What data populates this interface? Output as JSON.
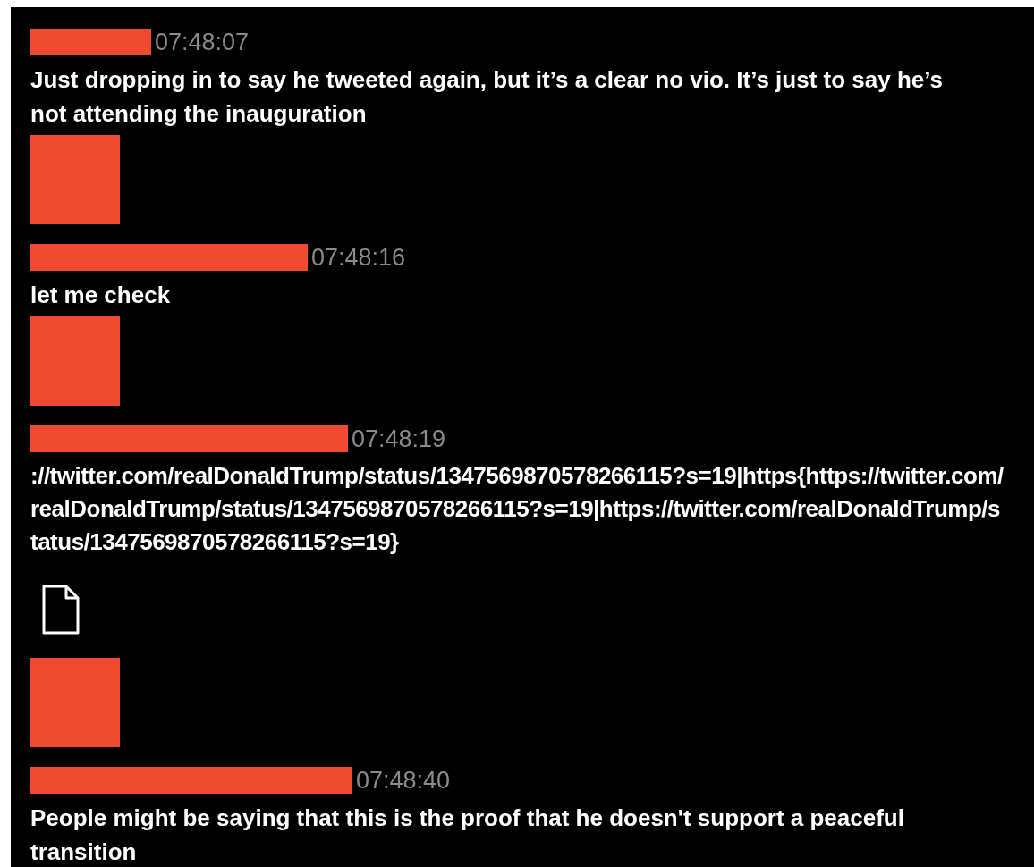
{
  "messages": [
    {
      "kind": "message",
      "avatar": false,
      "time": "07:48:07",
      "text": "Just dropping in to say he tweeted again, but it’s a clear no vio. It’s just to say he’s not attending the inauguration"
    },
    {
      "kind": "message",
      "avatar": true,
      "time": "07:48:16",
      "text": "let me check"
    },
    {
      "kind": "message",
      "avatar": true,
      "time": "07:48:19",
      "text": "://twitter.com/realDonaldTrump/status/1347569870578266115?s=19|https{https://twitter.com/realDonaldTrump/status/1347569870578266115?s=19|https://twitter.com/realDonaldTrump/status/1347569870578266115?s=19}"
    },
    {
      "kind": "attachment"
    },
    {
      "kind": "message",
      "avatar": true,
      "time": "07:48:40",
      "text": "People might be saying that this is the proof that he doesn't support a peaceful transition"
    }
  ]
}
